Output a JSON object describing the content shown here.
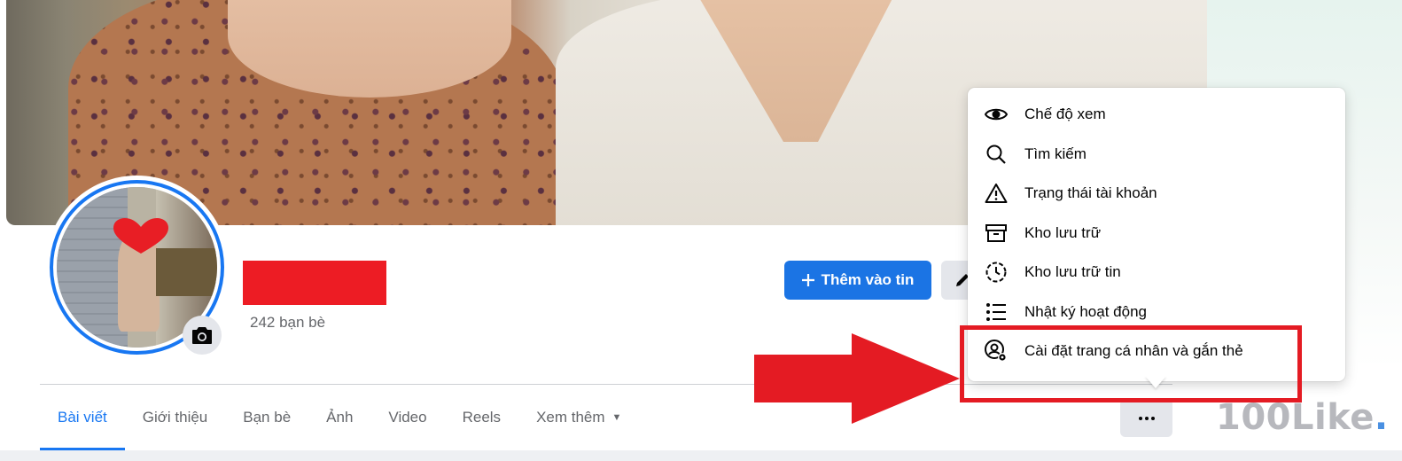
{
  "profile": {
    "friends_count": "242 bạn bè",
    "add_story_label": "Thêm vào tin"
  },
  "tabs": [
    {
      "label": "Bài viết",
      "active": true
    },
    {
      "label": "Giới thiệu"
    },
    {
      "label": "Bạn bè"
    },
    {
      "label": "Ảnh"
    },
    {
      "label": "Video"
    },
    {
      "label": "Reels"
    },
    {
      "label": "Xem thêm"
    }
  ],
  "menu": {
    "items": [
      {
        "label": "Chế độ xem",
        "icon": "eye-icon"
      },
      {
        "label": "Tìm kiếm",
        "icon": "search-icon"
      },
      {
        "label": "Trạng thái tài khoản",
        "icon": "warning-icon"
      },
      {
        "label": "Kho lưu trữ",
        "icon": "archive-icon"
      },
      {
        "label": "Kho lưu trữ tin",
        "icon": "story-archive-icon"
      },
      {
        "label": "Nhật ký hoạt động",
        "icon": "activity-log-icon"
      },
      {
        "label": "Cài đặt trang cá nhân và gắn thẻ",
        "icon": "profile-settings-icon"
      }
    ]
  },
  "watermark": {
    "text": "100Like",
    "dot": "."
  },
  "colors": {
    "accent": "#1877f2",
    "highlight_red": "#e41b23",
    "redaction": "#ed1c24"
  }
}
